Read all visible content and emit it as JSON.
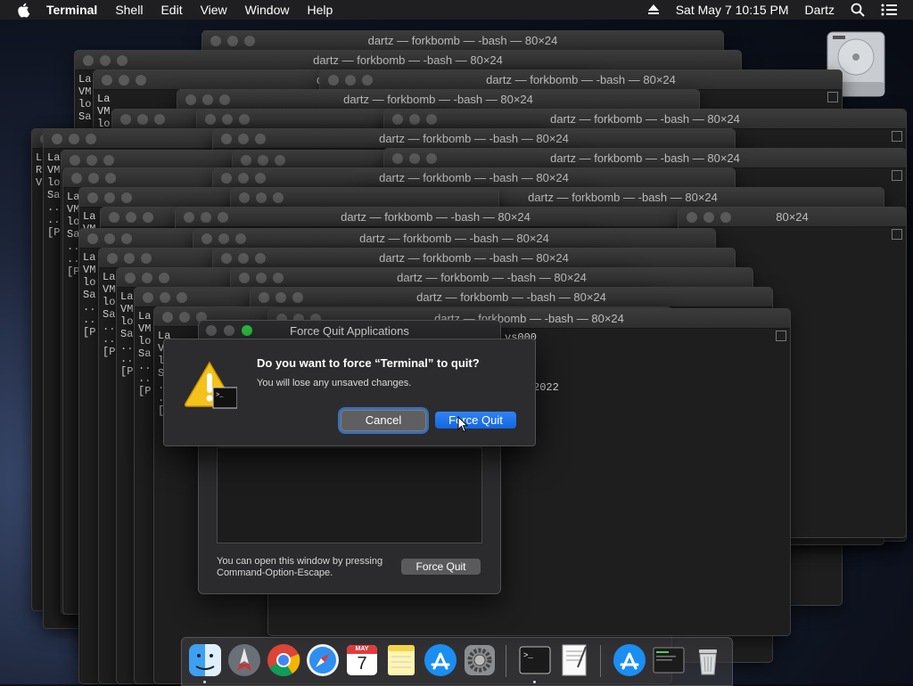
{
  "menubar": {
    "app_name": "Terminal",
    "menus": [
      "Shell",
      "Edit",
      "View",
      "Window",
      "Help"
    ],
    "clock": "Sat May 7  10:15 PM",
    "user": "Dartz"
  },
  "terminal": {
    "window_title": "dartz — forkbomb — -bash — 80×24",
    "title_fragment_1": "dartz — fo",
    "title_fragment_2": "80×24",
    "title_fragment_3": "dartz — forkbomb — -ba",
    "overflow_text": "-bash — 80×24",
    "line_prefixes": [
      "La",
      "VM",
      "lo",
      "Sa",
      "..",
      "..",
      "[P"
    ],
    "alt_prefixes": [
      "La",
      "Re",
      "VM"
    ],
    "fragment_ys": "ys000",
    "fragment_2022": "2022"
  },
  "force_quit": {
    "title": "Force Quit Applications",
    "hint": "You can open this window by pressing Command-Option-Escape.",
    "button": "Force Quit"
  },
  "alert": {
    "title": "Do you want to force “Terminal” to quit?",
    "message": "You will lose any unsaved changes.",
    "cancel": "Cancel",
    "confirm": "Force Quit"
  },
  "calendar": {
    "month": "MAY",
    "day": "7"
  },
  "dock": {
    "apps": [
      "finder-icon",
      "launchpad-icon",
      "chrome-icon",
      "safari-icon",
      "calendar-icon",
      "notes-icon",
      "app-store-icon",
      "system-preferences-icon",
      "terminal-icon",
      "textedit-icon",
      "app-store-download-icon",
      "console-icon",
      "trash-icon"
    ]
  },
  "colors": {
    "accent": "#1a73e8",
    "green_light": "#2ac140",
    "menubar": "#1f1f21"
  }
}
